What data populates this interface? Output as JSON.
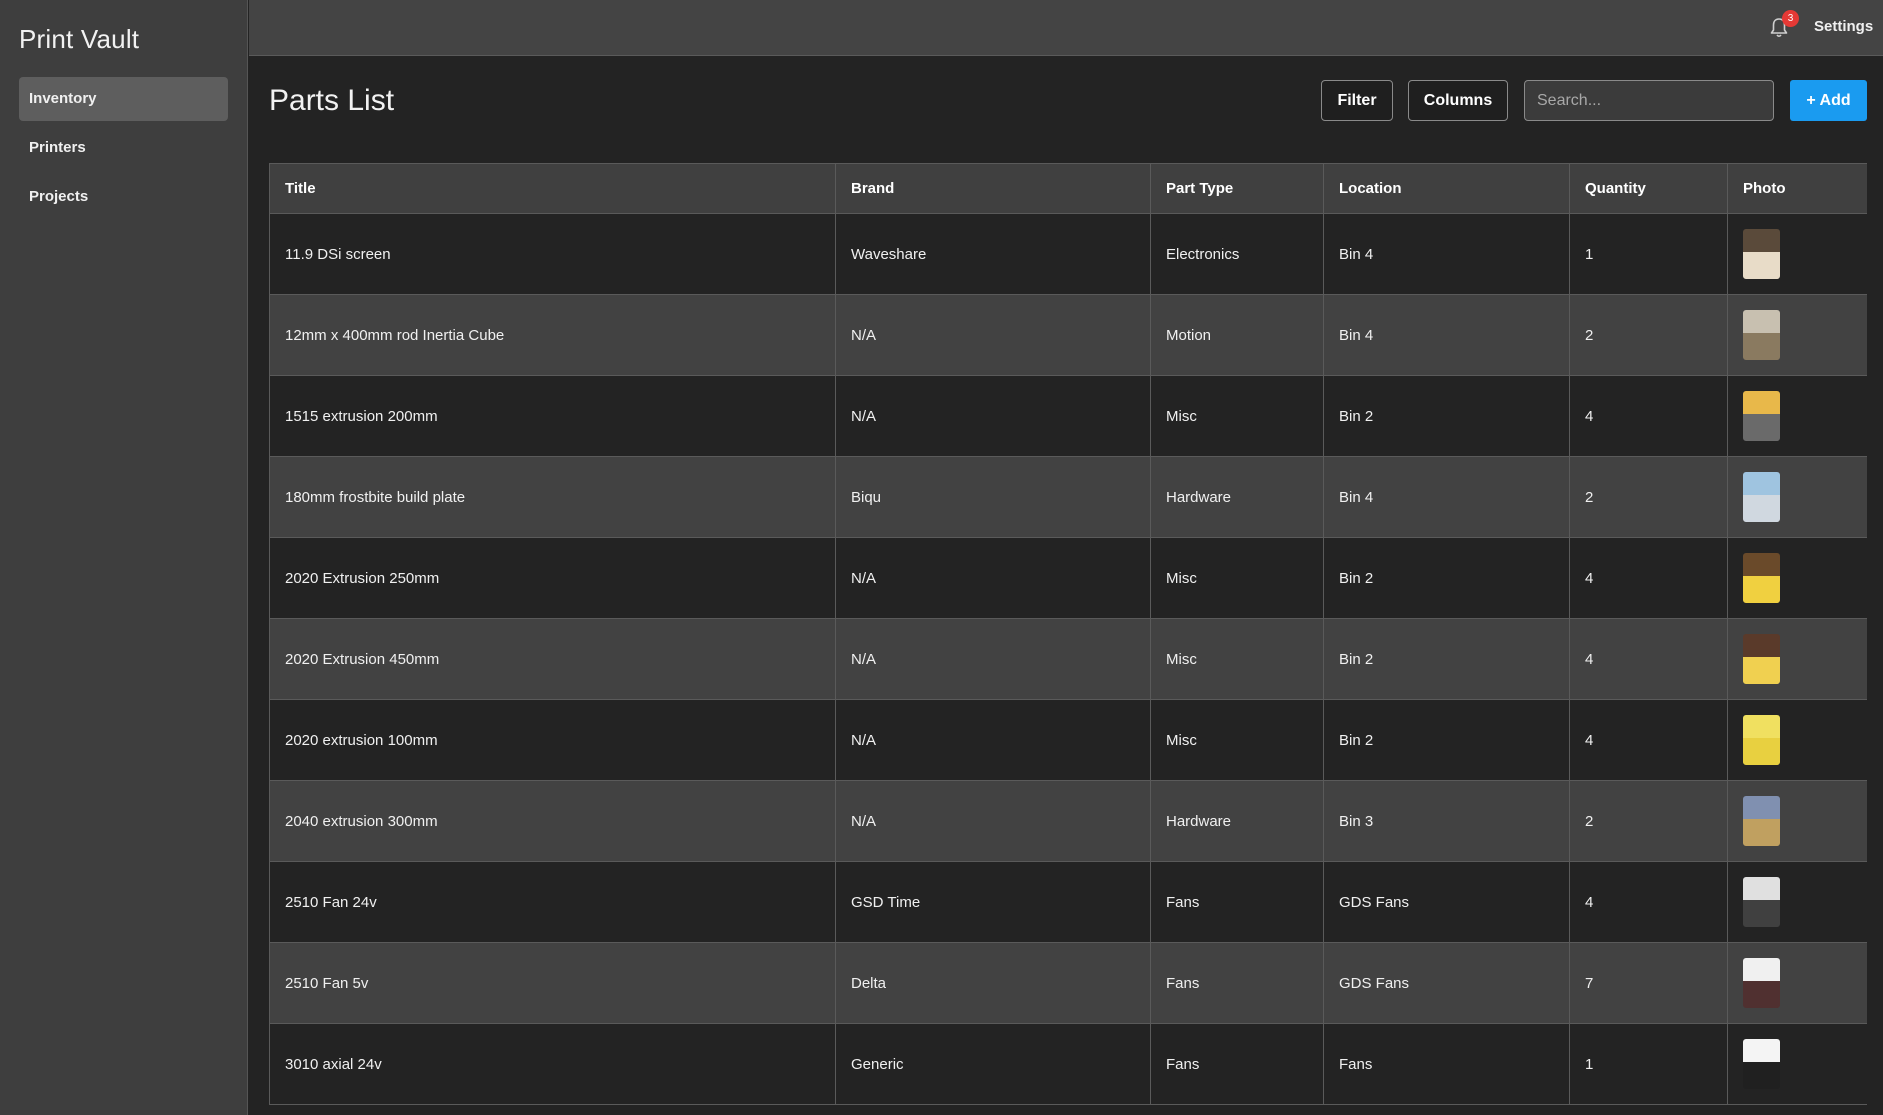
{
  "app": {
    "title": "Print Vault"
  },
  "sidebar": {
    "items": [
      {
        "label": "Inventory",
        "active": true
      },
      {
        "label": "Printers",
        "active": false
      },
      {
        "label": "Projects",
        "active": false
      }
    ]
  },
  "topbar": {
    "notification_count": "3",
    "settings_label": "Settings"
  },
  "page": {
    "title": "Parts List",
    "filter_label": "Filter",
    "columns_label": "Columns",
    "search_placeholder": "Search...",
    "add_label": "+ Add"
  },
  "table": {
    "headers": [
      "Title",
      "Brand",
      "Part Type",
      "Location",
      "Quantity",
      "Photo"
    ],
    "rows": [
      {
        "title": "11.9 DSi screen",
        "brand": "Waveshare",
        "part_type": "Electronics",
        "location": "Bin 4",
        "quantity": "1",
        "photo": {
          "top": "#5a4a3a",
          "bottom": "#e8dcc8"
        }
      },
      {
        "title": "12mm x 400mm rod Inertia Cube",
        "brand": "N/A",
        "part_type": "Motion",
        "location": "Bin 4",
        "quantity": "2",
        "photo": {
          "top": "#c8c0b0",
          "bottom": "#8a7a60"
        }
      },
      {
        "title": "1515 extrusion 200mm",
        "brand": "N/A",
        "part_type": "Misc",
        "location": "Bin 2",
        "quantity": "4",
        "photo": {
          "top": "#e8b84a",
          "bottom": "#6a6a6a"
        }
      },
      {
        "title": "180mm frostbite build plate",
        "brand": "Biqu",
        "part_type": "Hardware",
        "location": "Bin 4",
        "quantity": "2",
        "photo": {
          "top": "#9fc4e0",
          "bottom": "#d0d8e0"
        }
      },
      {
        "title": "2020 Extrusion 250mm",
        "brand": "N/A",
        "part_type": "Misc",
        "location": "Bin 2",
        "quantity": "4",
        "photo": {
          "top": "#6a4a2a",
          "bottom": "#f0d040"
        }
      },
      {
        "title": "2020 Extrusion 450mm",
        "brand": "N/A",
        "part_type": "Misc",
        "location": "Bin 2",
        "quantity": "4",
        "photo": {
          "top": "#5a3a2a",
          "bottom": "#f0d050"
        }
      },
      {
        "title": "2020 extrusion 100mm",
        "brand": "N/A",
        "part_type": "Misc",
        "location": "Bin 2",
        "quantity": "4",
        "photo": {
          "top": "#f0e060",
          "bottom": "#e8d040"
        }
      },
      {
        "title": "2040 extrusion 300mm",
        "brand": "N/A",
        "part_type": "Hardware",
        "location": "Bin 3",
        "quantity": "2",
        "photo": {
          "top": "#8090b0",
          "bottom": "#c0a060"
        }
      },
      {
        "title": "2510 Fan 24v",
        "brand": "GSD Time",
        "part_type": "Fans",
        "location": "GDS Fans",
        "quantity": "4",
        "photo": {
          "top": "#e0e0e0",
          "bottom": "#404040"
        }
      },
      {
        "title": "2510 Fan 5v",
        "brand": "Delta",
        "part_type": "Fans",
        "location": "GDS Fans",
        "quantity": "7",
        "photo": {
          "top": "#f0f0f0",
          "bottom": "#503030"
        }
      },
      {
        "title": "3010 axial 24v",
        "brand": "Generic",
        "part_type": "Fans",
        "location": "Fans",
        "quantity": "1",
        "photo": {
          "top": "#f4f4f4",
          "bottom": "#202020"
        }
      }
    ]
  },
  "colors": {
    "accent": "#1a9bf0",
    "badge": "#e53935",
    "sidebar_bg": "#3e3e3e",
    "page_bg": "#232323"
  },
  "icons": {
    "notifications": "bell-icon"
  }
}
